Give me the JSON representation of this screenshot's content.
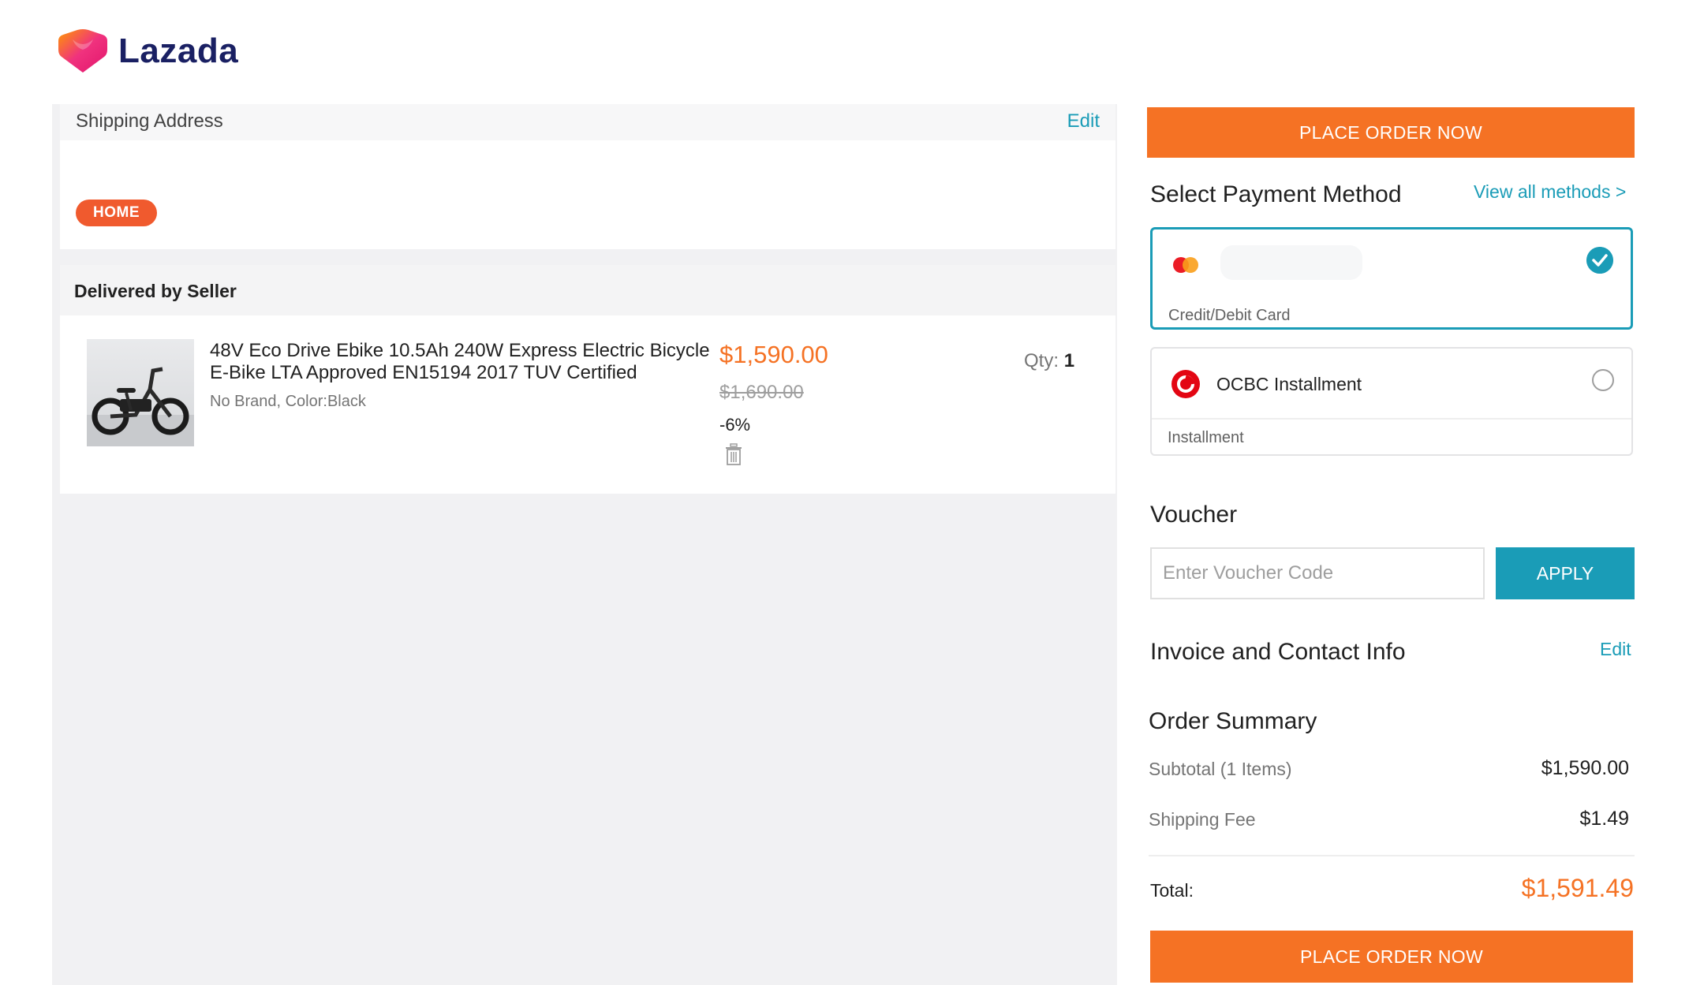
{
  "brand": {
    "name": "Lazada"
  },
  "shipping": {
    "title": "Shipping Address",
    "edit_label": "Edit",
    "tag": "HOME"
  },
  "seller": {
    "title": "Delivered by Seller",
    "product": {
      "name": "48V Eco Drive Ebike 10.5Ah 240W Express Electric Bicycle E-Bike LTA Approved EN15194 2017 TUV Certified",
      "meta": "No Brand, Color:Black",
      "price": "$1,590.00",
      "original_price": "$1,690.00",
      "discount": "-6%",
      "qty_label": "Qty:",
      "qty_value": "1"
    }
  },
  "payment": {
    "place_order_label": "PLACE ORDER NOW",
    "title": "Select Payment Method",
    "view_all_label": "View all methods >",
    "options": [
      {
        "label": "Credit/Debit Card",
        "selected": true
      },
      {
        "name": "OCBC Installment",
        "label": "Installment",
        "selected": false
      }
    ]
  },
  "voucher": {
    "title": "Voucher",
    "placeholder": "Enter Voucher Code",
    "apply_label": "APPLY"
  },
  "invoice": {
    "title": "Invoice and Contact Info",
    "edit_label": "Edit"
  },
  "summary": {
    "title": "Order Summary",
    "subtotal_label": "Subtotal (1 Items)",
    "subtotal_value": "$1,590.00",
    "shipping_label": "Shipping Fee",
    "shipping_value": "$1.49",
    "total_label": "Total:",
    "total_value": "$1,591.49"
  },
  "colors": {
    "accent_orange": "#f57224",
    "accent_teal": "#1a9cb7",
    "tag_red": "#f05a2e",
    "brand_navy": "#1a2063"
  }
}
